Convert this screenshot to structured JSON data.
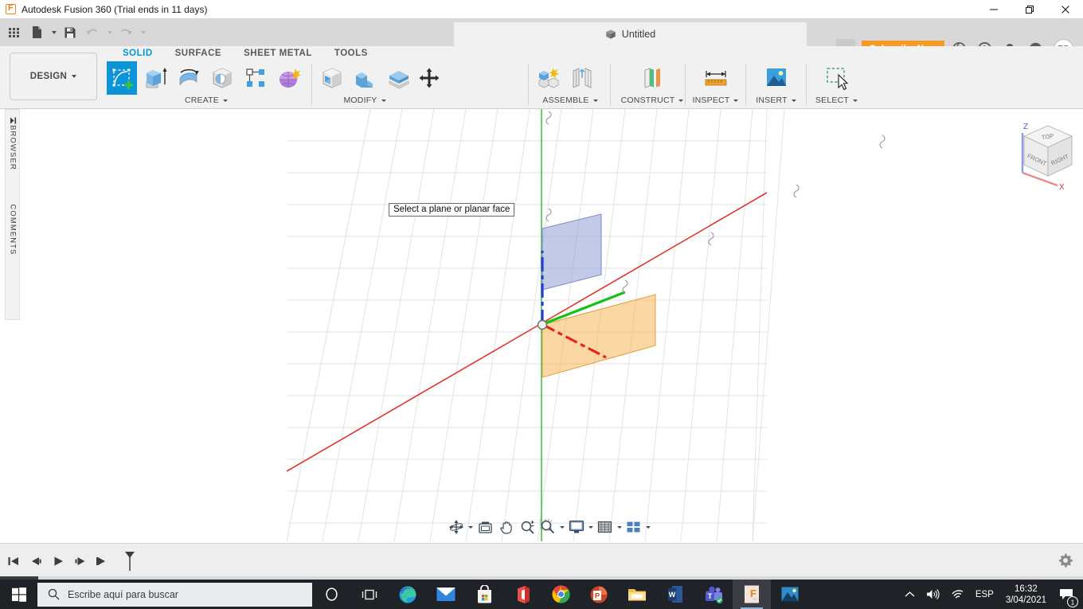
{
  "titlebar": {
    "title": "Autodesk Fusion 360 (Trial ends in 11 days)",
    "logo_icon": "fusion360-logo-icon",
    "minimize_icon": "minimize-icon",
    "maximize_icon": "restore-icon",
    "close_icon": "close-icon"
  },
  "appbar": {
    "grid_icon": "app-grid-icon",
    "new_icon": "new-document-icon",
    "save_icon": "save-icon",
    "undo_icon": "undo-icon",
    "redo_icon": "redo-icon",
    "document_tab": {
      "label": "Untitled",
      "icon": "cube-icon",
      "close_icon": "close-icon"
    },
    "new_tab_icon": "plus-icon",
    "subscribe_label": "Subscribe Now",
    "icons": [
      {
        "name": "data-panel-icon"
      },
      {
        "name": "job-status-clock-icon"
      },
      {
        "name": "notifications-bell-icon"
      },
      {
        "name": "help-question-icon"
      }
    ],
    "avatar_initials": "TG"
  },
  "ribbon": {
    "design_label": "DESIGN",
    "design_caret_icon": "chevron-down-icon",
    "workspace_tabs": [
      {
        "label": "SOLID",
        "active": true
      },
      {
        "label": "SURFACE",
        "active": false
      },
      {
        "label": "SHEET METAL",
        "active": false
      },
      {
        "label": "TOOLS",
        "active": false
      }
    ],
    "groups": [
      {
        "label": "CREATE",
        "caret_icon": "chevron-down-icon",
        "items": [
          {
            "name": "create-sketch-icon",
            "selected": true
          },
          {
            "name": "extrude-icon",
            "selected": false
          },
          {
            "name": "revolve-icon",
            "selected": false
          },
          {
            "name": "sweep-hole-icon",
            "selected": false
          },
          {
            "name": "pattern-icon",
            "selected": false
          },
          {
            "name": "form-icon",
            "selected": false
          }
        ]
      },
      {
        "label": "MODIFY",
        "caret_icon": "chevron-down-icon",
        "items": [
          {
            "name": "press-pull-icon",
            "selected": false
          },
          {
            "name": "fillet-icon",
            "selected": false
          },
          {
            "name": "shell-icon",
            "selected": false
          },
          {
            "name": "combine-icon",
            "selected": false
          },
          {
            "name": "move-copy-icon",
            "selected": false
          }
        ]
      },
      {
        "label": "ASSEMBLE",
        "caret_icon": "chevron-down-icon",
        "items": [
          {
            "name": "new-component-icon",
            "selected": false
          },
          {
            "name": "joint-icon",
            "selected": false
          }
        ]
      },
      {
        "label": "CONSTRUCT",
        "caret_icon": "chevron-down-icon",
        "items": [
          {
            "name": "offset-plane-icon",
            "selected": false
          }
        ]
      },
      {
        "label": "INSPECT",
        "caret_icon": "chevron-down-icon",
        "items": [
          {
            "name": "measure-icon",
            "selected": false
          }
        ]
      },
      {
        "label": "INSERT",
        "caret_icon": "chevron-down-icon",
        "items": [
          {
            "name": "insert-image-icon",
            "selected": false
          }
        ]
      },
      {
        "label": "SELECT",
        "caret_icon": "chevron-down-icon",
        "items": [
          {
            "name": "select-window-icon",
            "selected": false
          }
        ]
      }
    ]
  },
  "left_rail": {
    "expand_icon": "expand-panel-icon",
    "browser_label": "BROWSER",
    "comments_label": "COMMENTS"
  },
  "canvas": {
    "tooltip_text": "Select a plane or planar face",
    "viewcube": {
      "top_label": "TOP",
      "front_label": "FRONT",
      "right_label": "RIGHT",
      "axis_z_label": "Z",
      "axis_x_label": "X"
    },
    "planes": [
      {
        "name": "xz-plane",
        "color": "#8f9ed6"
      },
      {
        "name": "xy-plane",
        "color": "#f5b352"
      }
    ],
    "axes": [
      {
        "name": "x-axis",
        "color": "#e03b32"
      },
      {
        "name": "y-axis",
        "color": "#2fc12f"
      },
      {
        "name": "z-axis",
        "color": "#1f3fd1"
      }
    ],
    "navbar": [
      {
        "name": "orbit-icon",
        "has_caret": true
      },
      {
        "name": "look-at-icon",
        "has_caret": false
      },
      {
        "name": "pan-icon",
        "has_caret": false
      },
      {
        "name": "zoom-icon",
        "has_caret": false
      },
      {
        "name": "zoom-window-icon",
        "has_caret": true
      },
      {
        "name": "display-settings-icon",
        "has_caret": true
      },
      {
        "name": "grid-snaps-icon",
        "has_caret": true
      },
      {
        "name": "viewports-icon",
        "has_caret": true
      }
    ]
  },
  "timeline": {
    "controls": [
      {
        "name": "go-to-beginning-icon"
      },
      {
        "name": "step-back-icon"
      },
      {
        "name": "play-icon"
      },
      {
        "name": "step-forward-icon"
      },
      {
        "name": "go-to-end-icon"
      },
      {
        "name": "timeline-marker-icon"
      }
    ],
    "settings_icon": "gear-icon"
  },
  "taskbar": {
    "start_icon": "windows-start-icon",
    "search_icon": "search-icon",
    "search_placeholder": "Escribe aquí para buscar",
    "icons": [
      {
        "name": "cortana-icon"
      },
      {
        "name": "task-view-icon"
      },
      {
        "name": "microsoft-edge-icon"
      },
      {
        "name": "mail-icon"
      },
      {
        "name": "microsoft-store-icon"
      },
      {
        "name": "office-icon"
      },
      {
        "name": "google-chrome-icon"
      },
      {
        "name": "powerpoint-icon"
      },
      {
        "name": "file-explorer-icon"
      },
      {
        "name": "word-icon"
      },
      {
        "name": "microsoft-teams-icon"
      },
      {
        "name": "fusion360-icon",
        "active": true
      },
      {
        "name": "photos-icon"
      }
    ],
    "tray": {
      "chevron_up_icon": "chevron-up-icon",
      "volume_icon": "volume-icon",
      "network_icon": "wifi-icon",
      "language": "ESP",
      "time": "16:32",
      "date": "3/04/2021",
      "action_center_icon": "action-center-icon",
      "notification_count": "1"
    }
  }
}
